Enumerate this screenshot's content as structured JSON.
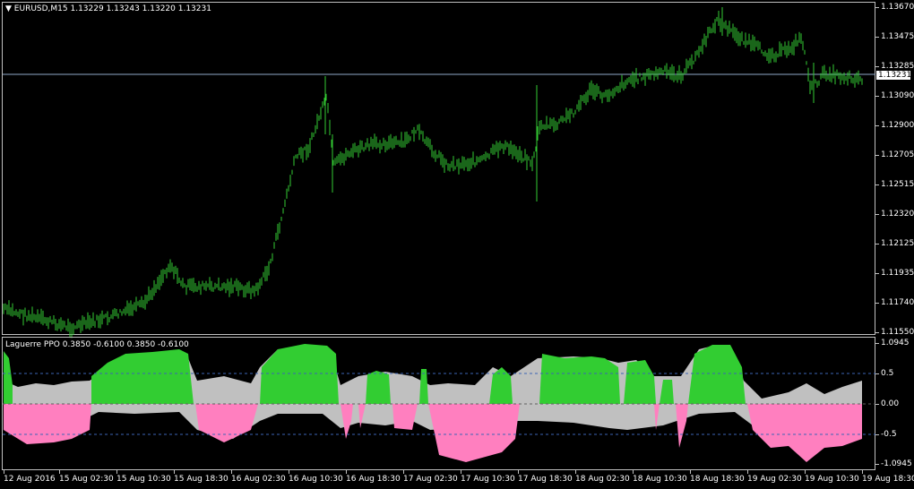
{
  "main_chart": {
    "title": "EURUSD,M15  1.13229 1.13243 1.13220 1.13231",
    "current_price": "1.13231",
    "price_levels": [
      "1.13670",
      "1.13475",
      "1.13285",
      "1.13090",
      "1.12900",
      "1.12705",
      "1.12515",
      "1.12320",
      "1.12125",
      "1.11935",
      "1.11740",
      "1.11550"
    ]
  },
  "indicator": {
    "title": "Laguerre PPO 0.3850 -0.6100 0.3850 -0.6100",
    "levels": [
      "1.0945",
      "0.5",
      "0.00",
      "-0.5",
      "-1.0945"
    ]
  },
  "time_axis": {
    "labels": [
      "12 Aug 2016",
      "15 Aug 02:30",
      "15 Aug 10:30",
      "15 Aug 18:30",
      "16 Aug 02:30",
      "16 Aug 10:30",
      "16 Aug 18:30",
      "17 Aug 02:30",
      "17 Aug 10:30",
      "17 Aug 18:30",
      "18 Aug 02:30",
      "18 Aug 10:30",
      "18 Aug 18:30",
      "19 Aug 02:30",
      "19 Aug 10:30",
      "19 Aug 18:30"
    ]
  },
  "colors": {
    "bars": "#33cc33",
    "positive_fill": "#32cd32",
    "negative_fill": "#ff7fbf",
    "signal_fill": "#c0c0c0",
    "grid_border": "#c0c0c0",
    "current_price_line": "#8fa7c8",
    "level_line": "#3c64b4"
  }
}
